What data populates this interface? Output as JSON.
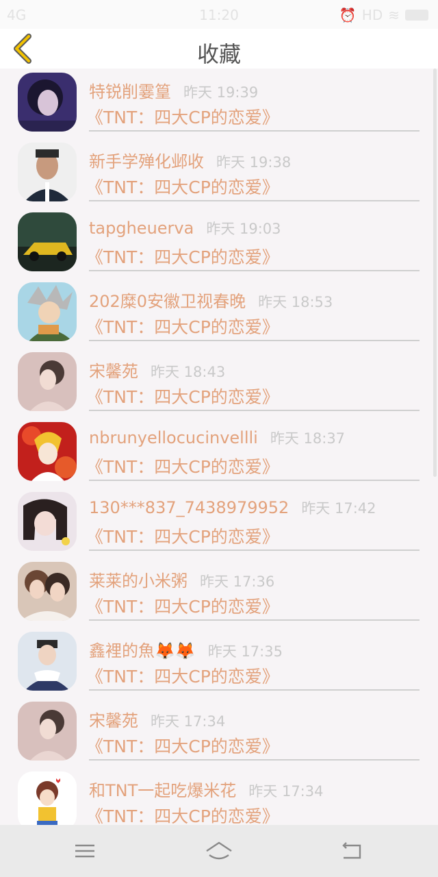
{
  "status_bar": {
    "signal": "4G",
    "time": "11:20",
    "network": "HD"
  },
  "header": {
    "title": "收藏"
  },
  "items": [
    {
      "name": "特锐削霎篁",
      "time": "昨天 19:39",
      "book": "《TNT：四大CP的恋爱》",
      "avatar": "avatar-girl-dark"
    },
    {
      "name": "新手学殚化邺收",
      "time": "昨天 19:38",
      "book": "《TNT：四大CP的恋爱》",
      "avatar": "avatar-man-glasses"
    },
    {
      "name": "tapgheuerva",
      "time": "昨天 19:03",
      "book": "《TNT：四大CP的恋爱》",
      "avatar": "avatar-car"
    },
    {
      "name": "202糜0安徽卫视春晚",
      "time": "昨天 18:53",
      "book": "《TNT：四大CP的恋爱》",
      "avatar": "avatar-anime-ninja"
    },
    {
      "name": "宋馨苑",
      "time": "昨天 18:43",
      "book": "《TNT：四大CP的恋爱》",
      "avatar": "avatar-girl-pink"
    },
    {
      "name": "nbrunyellocucinvellli",
      "time": "昨天 18:37",
      "book": "《TNT：四大CP的恋爱》",
      "avatar": "avatar-anime-red"
    },
    {
      "name": "130***837_7438979952",
      "time": "昨天 17:42",
      "book": "《TNT：四大CP的恋爱》",
      "avatar": "avatar-girl-flower"
    },
    {
      "name": "莱莱的小米粥",
      "time": "昨天 17:36",
      "book": "《TNT：四大CP的恋爱》",
      "avatar": "avatar-two-girls"
    },
    {
      "name": "鑫裡的魚🦊🦊",
      "time": "昨天 17:35",
      "book": "《TNT：四大CP的恋爱》",
      "avatar": "avatar-boy-snow"
    },
    {
      "name": "宋馨苑",
      "time": "昨天 17:34",
      "book": "《TNT：四大CP的恋爱》",
      "avatar": "avatar-girl-pink"
    },
    {
      "name": "和TNT一起吃爆米花",
      "time": "昨天 17:34",
      "book": "《TNT：四大CP的恋爱》",
      "avatar": "avatar-cartoon-girl"
    }
  ],
  "colors": {
    "accent": "#e3a27c",
    "time": "#c9c9c9",
    "background": "#f7f4f6"
  },
  "icons": {
    "back": "chevron-left-icon",
    "menu": "menu-icon",
    "home": "home-icon",
    "return": "return-icon"
  }
}
